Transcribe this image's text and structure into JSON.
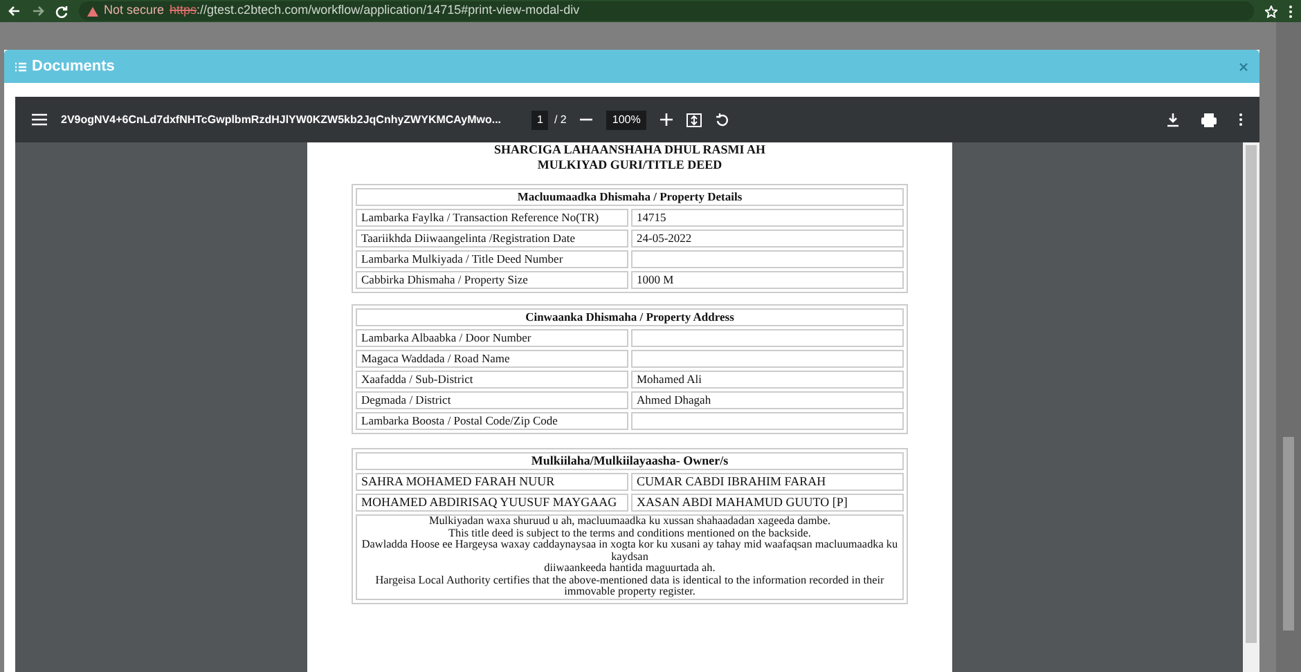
{
  "browser": {
    "security": "Not secure",
    "url_scheme": "https",
    "url_rest": "://gtest.c2btech.com/workflow/application/14715#print-view-modal-div"
  },
  "modal": {
    "title": "Documents"
  },
  "pdf_toolbar": {
    "filename": "2V9ogNV4+6CnLd7dxfNHTcGwplbmRzdHJlYW0KZW5kb2JqCnhyZWYKMCAyMwo...",
    "page": "1",
    "page_total": "/ 2",
    "zoom": "100%"
  },
  "document": {
    "title_lines": [
      "SHARCIGA LAHAANSHAHA DHUL RASMI AH",
      "MULKIYAD GURI/TITLE DEED"
    ],
    "sections": [
      {
        "heading": "Macluumaadka Dhismaha / Property Details",
        "rows": [
          [
            "Lambarka Faylka / Transaction Reference No(TR)",
            "14715"
          ],
          [
            "Taariikhda Diiwaangelinta /Registration Date",
            "24-05-2022"
          ],
          [
            "Lambarka Mulkiyada / Title Deed Number",
            ""
          ],
          [
            "Cabbirka Dhismaha / Property Size",
            "1000 M"
          ]
        ]
      },
      {
        "heading": "Cinwaanka Dhismaha / Property Address",
        "rows": [
          [
            "Lambarka Albaabka / Door Number",
            ""
          ],
          [
            "Magaca Waddada / Road Name",
            ""
          ],
          [
            "Xaafadda / Sub-District",
            "Mohamed Ali"
          ],
          [
            "Degmada / District",
            "Ahmed Dhagah"
          ],
          [
            "Lambarka Boosta / Postal Code/Zip Code",
            ""
          ]
        ]
      }
    ],
    "owners": {
      "heading": "Mulkiilaha/Mulkiilayaasha- Owner/s",
      "rows": [
        [
          "SAHRA MOHAMED FARAH NUUR",
          "CUMAR CABDI IBRAHIM FARAH"
        ],
        [
          "MOHAMED ABDIRISAQ YUUSUF MAYGAAG",
          "XASAN ABDI MAHAMUD GUUTO [P]"
        ]
      ]
    },
    "notes": [
      "Mulkiyadan waxa shuruud u ah, macluumaadka ku xussan shahaadadan xageeda dambe.",
      "This title deed is subject to the terms and conditions mentioned on the backside.",
      "Dawladda Hoose ee Hargeysa waxay caddaynaysaa in xogta kor ku xusani ay tahay mid waafaqsan macluumaadka ku kaydsan",
      "diiwaankeeda hantida maguurtada ah.",
      "Hargeisa Local Authority certifies that the above-mentioned data is identical to the information recorded in their immovable property register."
    ]
  }
}
